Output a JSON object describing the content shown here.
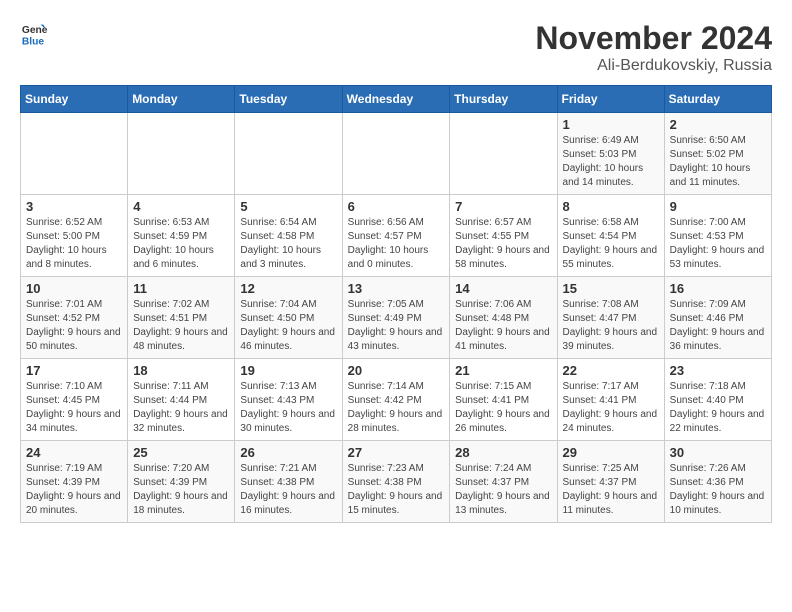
{
  "logo": {
    "general": "General",
    "blue": "Blue"
  },
  "title": {
    "month": "November 2024",
    "location": "Ali-Berdukovskiy, Russia"
  },
  "headers": [
    "Sunday",
    "Monday",
    "Tuesday",
    "Wednesday",
    "Thursday",
    "Friday",
    "Saturday"
  ],
  "weeks": [
    [
      {
        "day": "",
        "info": ""
      },
      {
        "day": "",
        "info": ""
      },
      {
        "day": "",
        "info": ""
      },
      {
        "day": "",
        "info": ""
      },
      {
        "day": "",
        "info": ""
      },
      {
        "day": "1",
        "info": "Sunrise: 6:49 AM\nSunset: 5:03 PM\nDaylight: 10 hours and 14 minutes."
      },
      {
        "day": "2",
        "info": "Sunrise: 6:50 AM\nSunset: 5:02 PM\nDaylight: 10 hours and 11 minutes."
      }
    ],
    [
      {
        "day": "3",
        "info": "Sunrise: 6:52 AM\nSunset: 5:00 PM\nDaylight: 10 hours and 8 minutes."
      },
      {
        "day": "4",
        "info": "Sunrise: 6:53 AM\nSunset: 4:59 PM\nDaylight: 10 hours and 6 minutes."
      },
      {
        "day": "5",
        "info": "Sunrise: 6:54 AM\nSunset: 4:58 PM\nDaylight: 10 hours and 3 minutes."
      },
      {
        "day": "6",
        "info": "Sunrise: 6:56 AM\nSunset: 4:57 PM\nDaylight: 10 hours and 0 minutes."
      },
      {
        "day": "7",
        "info": "Sunrise: 6:57 AM\nSunset: 4:55 PM\nDaylight: 9 hours and 58 minutes."
      },
      {
        "day": "8",
        "info": "Sunrise: 6:58 AM\nSunset: 4:54 PM\nDaylight: 9 hours and 55 minutes."
      },
      {
        "day": "9",
        "info": "Sunrise: 7:00 AM\nSunset: 4:53 PM\nDaylight: 9 hours and 53 minutes."
      }
    ],
    [
      {
        "day": "10",
        "info": "Sunrise: 7:01 AM\nSunset: 4:52 PM\nDaylight: 9 hours and 50 minutes."
      },
      {
        "day": "11",
        "info": "Sunrise: 7:02 AM\nSunset: 4:51 PM\nDaylight: 9 hours and 48 minutes."
      },
      {
        "day": "12",
        "info": "Sunrise: 7:04 AM\nSunset: 4:50 PM\nDaylight: 9 hours and 46 minutes."
      },
      {
        "day": "13",
        "info": "Sunrise: 7:05 AM\nSunset: 4:49 PM\nDaylight: 9 hours and 43 minutes."
      },
      {
        "day": "14",
        "info": "Sunrise: 7:06 AM\nSunset: 4:48 PM\nDaylight: 9 hours and 41 minutes."
      },
      {
        "day": "15",
        "info": "Sunrise: 7:08 AM\nSunset: 4:47 PM\nDaylight: 9 hours and 39 minutes."
      },
      {
        "day": "16",
        "info": "Sunrise: 7:09 AM\nSunset: 4:46 PM\nDaylight: 9 hours and 36 minutes."
      }
    ],
    [
      {
        "day": "17",
        "info": "Sunrise: 7:10 AM\nSunset: 4:45 PM\nDaylight: 9 hours and 34 minutes."
      },
      {
        "day": "18",
        "info": "Sunrise: 7:11 AM\nSunset: 4:44 PM\nDaylight: 9 hours and 32 minutes."
      },
      {
        "day": "19",
        "info": "Sunrise: 7:13 AM\nSunset: 4:43 PM\nDaylight: 9 hours and 30 minutes."
      },
      {
        "day": "20",
        "info": "Sunrise: 7:14 AM\nSunset: 4:42 PM\nDaylight: 9 hours and 28 minutes."
      },
      {
        "day": "21",
        "info": "Sunrise: 7:15 AM\nSunset: 4:41 PM\nDaylight: 9 hours and 26 minutes."
      },
      {
        "day": "22",
        "info": "Sunrise: 7:17 AM\nSunset: 4:41 PM\nDaylight: 9 hours and 24 minutes."
      },
      {
        "day": "23",
        "info": "Sunrise: 7:18 AM\nSunset: 4:40 PM\nDaylight: 9 hours and 22 minutes."
      }
    ],
    [
      {
        "day": "24",
        "info": "Sunrise: 7:19 AM\nSunset: 4:39 PM\nDaylight: 9 hours and 20 minutes."
      },
      {
        "day": "25",
        "info": "Sunrise: 7:20 AM\nSunset: 4:39 PM\nDaylight: 9 hours and 18 minutes."
      },
      {
        "day": "26",
        "info": "Sunrise: 7:21 AM\nSunset: 4:38 PM\nDaylight: 9 hours and 16 minutes."
      },
      {
        "day": "27",
        "info": "Sunrise: 7:23 AM\nSunset: 4:38 PM\nDaylight: 9 hours and 15 minutes."
      },
      {
        "day": "28",
        "info": "Sunrise: 7:24 AM\nSunset: 4:37 PM\nDaylight: 9 hours and 13 minutes."
      },
      {
        "day": "29",
        "info": "Sunrise: 7:25 AM\nSunset: 4:37 PM\nDaylight: 9 hours and 11 minutes."
      },
      {
        "day": "30",
        "info": "Sunrise: 7:26 AM\nSunset: 4:36 PM\nDaylight: 9 hours and 10 minutes."
      }
    ]
  ]
}
